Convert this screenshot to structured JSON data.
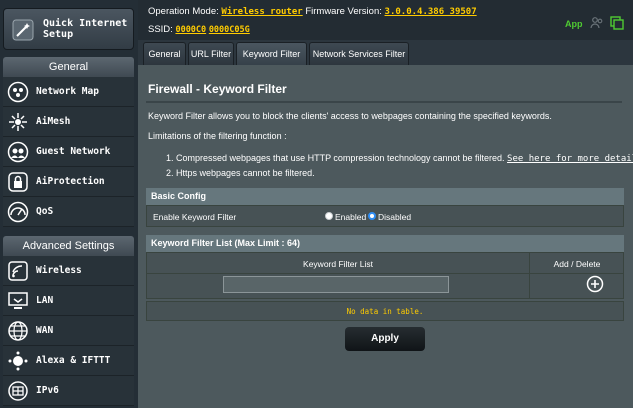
{
  "sidebar": {
    "quick_setup_label": "Quick Internet Setup",
    "general_header": "General",
    "general_items": [
      {
        "label": "Network Map",
        "icon": "network-map-icon"
      },
      {
        "label": "AiMesh",
        "icon": "aimesh-icon"
      },
      {
        "label": "Guest Network",
        "icon": "guest-network-icon"
      },
      {
        "label": "AiProtection",
        "icon": "lock-icon"
      },
      {
        "label": "QoS",
        "icon": "speedometer-icon"
      }
    ],
    "advanced_header": "Advanced Settings",
    "advanced_items": [
      {
        "label": "Wireless",
        "icon": "wifi-icon"
      },
      {
        "label": "LAN",
        "icon": "monitor-icon"
      },
      {
        "label": "WAN",
        "icon": "globe-icon"
      },
      {
        "label": "Alexa & IFTTT",
        "icon": "alexa-icon"
      },
      {
        "label": "IPv6",
        "icon": "ipv6-icon"
      }
    ]
  },
  "banner": {
    "operation_mode_label": "Operation Mode:",
    "operation_mode_value": "Wireless router",
    "firmware_label": "Firmware Version:",
    "firmware_value": "3.0.0.4.386_39507",
    "ssid_label": "SSID:",
    "ssid_values": [
      "0000C0",
      "0000C05G"
    ],
    "app_label": "App"
  },
  "tabs": [
    "General",
    "URL Filter",
    "Keyword Filter",
    "Network Services Filter"
  ],
  "active_tab": "Keyword Filter",
  "main": {
    "title": "Firewall - Keyword Filter",
    "description": "Keyword Filter allows you to block the clients' access to webpages containing the specified keywords.",
    "limitations_intro": "Limitations of the filtering function :",
    "limitation_1_text": "1. Compressed webpages that use HTTP compression technology cannot be filtered.",
    "limitation_1_link": "See here for more details.",
    "limitation_2_text": "2. Https webpages cannot be filtered.",
    "basic_config": {
      "header": "Basic Config",
      "enable_label": "Enable Keyword Filter",
      "enabled_option": "Enabled",
      "disabled_option": "Disabled",
      "selected": "Disabled"
    },
    "keyword_list": {
      "header": "Keyword Filter List (Max Limit : 64)",
      "col_list": "Keyword Filter List",
      "col_add_delete": "Add / Delete",
      "input_value": "",
      "no_data": "No data in table."
    },
    "apply_label": "Apply"
  },
  "colors": {
    "accent_yellow": "#ffcc00",
    "app_green": "#4fcb32",
    "radio_selected": "#2e8df5",
    "panel": "#4d595d"
  }
}
